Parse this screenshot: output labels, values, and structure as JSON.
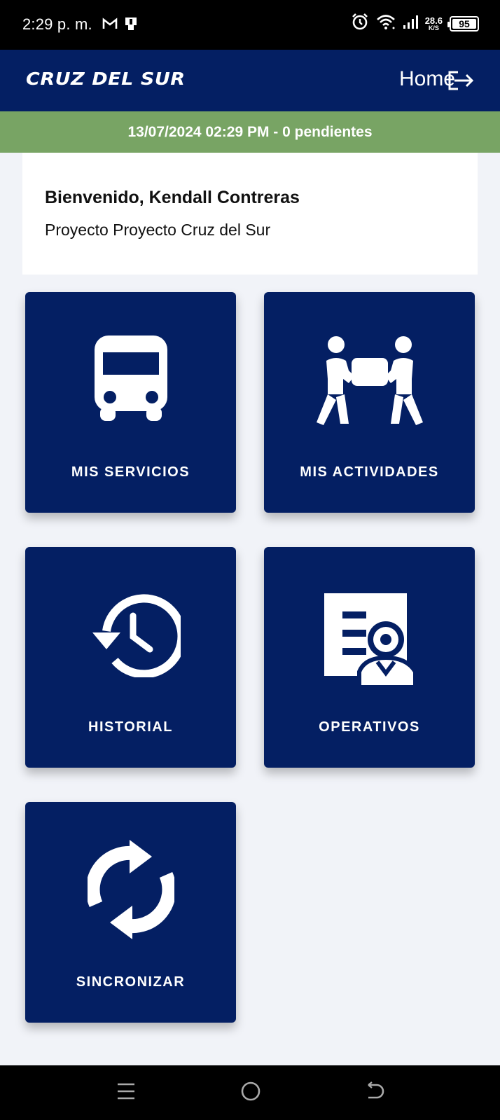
{
  "status_bar": {
    "time": "2:29 p. m.",
    "network_speed_value": "28.6",
    "network_speed_unit": "K/S",
    "battery": "95",
    "icons": [
      "gmail-icon",
      "notification-icon",
      "alarm-icon",
      "wifi-icon",
      "signal-icon",
      "battery-icon"
    ]
  },
  "header": {
    "brand": "CRUZ DEL SUR",
    "home_label": "Home",
    "logout_icon": "logout-icon",
    "background": "#041f63"
  },
  "sync_bar": {
    "text": "13/07/2024 02:29 PM - 0 pendientes",
    "background": "#78a464"
  },
  "welcome": {
    "greeting": "Bienvenido, Kendall Contreras",
    "project": "Proyecto Proyecto Cruz del Sur"
  },
  "menu": [
    {
      "label": "MIS SERVICIOS",
      "icon": "bus-icon"
    },
    {
      "label": "MIS ACTIVIDADES",
      "icon": "people-carrying-box-icon"
    },
    {
      "label": "HISTORIAL",
      "icon": "history-icon"
    },
    {
      "label": "OPERATIVOS",
      "icon": "operator-document-icon"
    },
    {
      "label": "SINCRONIZAR",
      "icon": "sync-icon"
    }
  ],
  "nav_bar": [
    "menu-icon",
    "home-circle-icon",
    "back-icon"
  ]
}
